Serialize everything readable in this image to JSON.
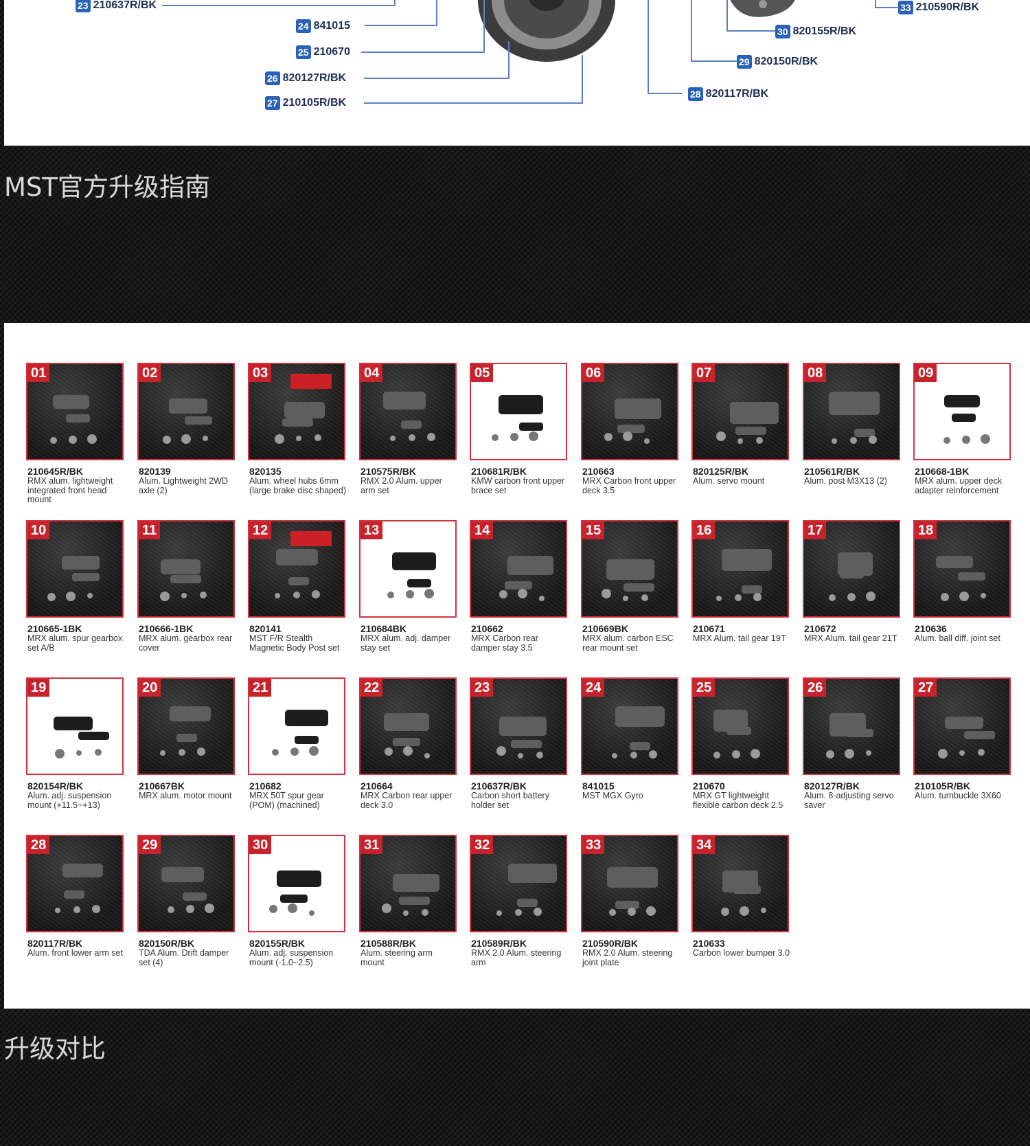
{
  "diagram": {
    "callouts": [
      {
        "n": "23",
        "code": "210637R/BK"
      },
      {
        "n": "24",
        "code": "841015"
      },
      {
        "n": "25",
        "code": "210670"
      },
      {
        "n": "26",
        "code": "820127R/BK"
      },
      {
        "n": "27",
        "code": "210105R/BK"
      },
      {
        "n": "30",
        "code": "820155R/BK"
      },
      {
        "n": "29",
        "code": "820150R/BK"
      },
      {
        "n": "28",
        "code": "820117R/BK"
      },
      {
        "n": "33",
        "code": "210590R/BK"
      }
    ]
  },
  "sections": {
    "upgrade_guide": "MST官方升级指南",
    "comparison": "升级对比"
  },
  "catalog": {
    "items": [
      {
        "n": "01",
        "code": "210645R/BK",
        "desc": "RMX alum. lightweight integrated front head mount"
      },
      {
        "n": "02",
        "code": "820139",
        "desc": "Alum. Lightweight 2WD axle (2)"
      },
      {
        "n": "03",
        "code": "820135",
        "desc": "Alum. wheel hubs 6mm (large brake disc shaped)"
      },
      {
        "n": "04",
        "code": "210575R/BK",
        "desc": "RMX 2.0 Alum. upper arm set"
      },
      {
        "n": "05",
        "code": "210681R/BK",
        "desc": "KMW carbon front upper brace set"
      },
      {
        "n": "06",
        "code": "210663",
        "desc": "MRX Carbon front upper deck 3.5"
      },
      {
        "n": "07",
        "code": "820125R/BK",
        "desc": "Alum. servo mount"
      },
      {
        "n": "08",
        "code": "210561R/BK",
        "desc": "Alum. post M3X13 (2)"
      },
      {
        "n": "09",
        "code": "210668-1BK",
        "desc": "MRX alum. upper deck adapter reinforcement"
      },
      {
        "n": "10",
        "code": "210665-1BK",
        "desc": "MRX alum. spur gearbox set A/B"
      },
      {
        "n": "11",
        "code": "210666-1BK",
        "desc": "MRX alum. gearbox rear cover"
      },
      {
        "n": "12",
        "code": "820141",
        "desc": "MST F/R Stealth Magnetic Body Post set"
      },
      {
        "n": "13",
        "code": "210684BK",
        "desc": "MRX alum. adj. damper stay set"
      },
      {
        "n": "14",
        "code": "210662",
        "desc": "MRX Carbon rear damper stay 3.5"
      },
      {
        "n": "15",
        "code": "210669BK",
        "desc": "MRX alum. carbon ESC rear mount set"
      },
      {
        "n": "16",
        "code": "210671",
        "desc": "MRX Alum. tail gear 19T"
      },
      {
        "n": "17",
        "code": "210672",
        "desc": "MRX Alum. tail gear 21T"
      },
      {
        "n": "18",
        "code": "210636",
        "desc": "Alum. ball diff. joint set"
      },
      {
        "n": "19",
        "code": "820154R/BK",
        "desc": "Alum. adj. suspension mount (+11.5~+13)"
      },
      {
        "n": "20",
        "code": "210667BK",
        "desc": "MRX alum. motor mount"
      },
      {
        "n": "21",
        "code": "210682",
        "desc": "MRX 50T spur gear (POM) (machined)"
      },
      {
        "n": "22",
        "code": "210664",
        "desc": "MRX Carbon rear upper deck 3.0"
      },
      {
        "n": "23",
        "code": "210637R/BK",
        "desc": "Carbon short battery holder set"
      },
      {
        "n": "24",
        "code": "841015",
        "desc": "MST MGX Gyro"
      },
      {
        "n": "25",
        "code": "210670",
        "desc": "MRX GT lightweight flexible carbon deck 2.5"
      },
      {
        "n": "26",
        "code": "820127R/BK",
        "desc": "Alum. 8-adjusting servo saver"
      },
      {
        "n": "27",
        "code": "210105R/BK",
        "desc": "Alum. turnbuckle 3X60"
      },
      {
        "n": "28",
        "code": "820117R/BK",
        "desc": "Alum. front lower arm set"
      },
      {
        "n": "29",
        "code": "820150R/BK",
        "desc": "TDA Alum. Drift damper set (4)"
      },
      {
        "n": "30",
        "code": "820155R/BK",
        "desc": "Alum. adj. suspension mount (-1.0~2.5)"
      },
      {
        "n": "31",
        "code": "210588R/BK",
        "desc": "Alum. steering arm mount"
      },
      {
        "n": "32",
        "code": "210589R/BK",
        "desc": "RMX 2.0 Alum. steering arm"
      },
      {
        "n": "33",
        "code": "210590R/BK",
        "desc": "RMX 2.0 Alum. steering joint plate"
      },
      {
        "n": "34",
        "code": "210633",
        "desc": "Carbon lower bumper 3.0"
      }
    ]
  }
}
